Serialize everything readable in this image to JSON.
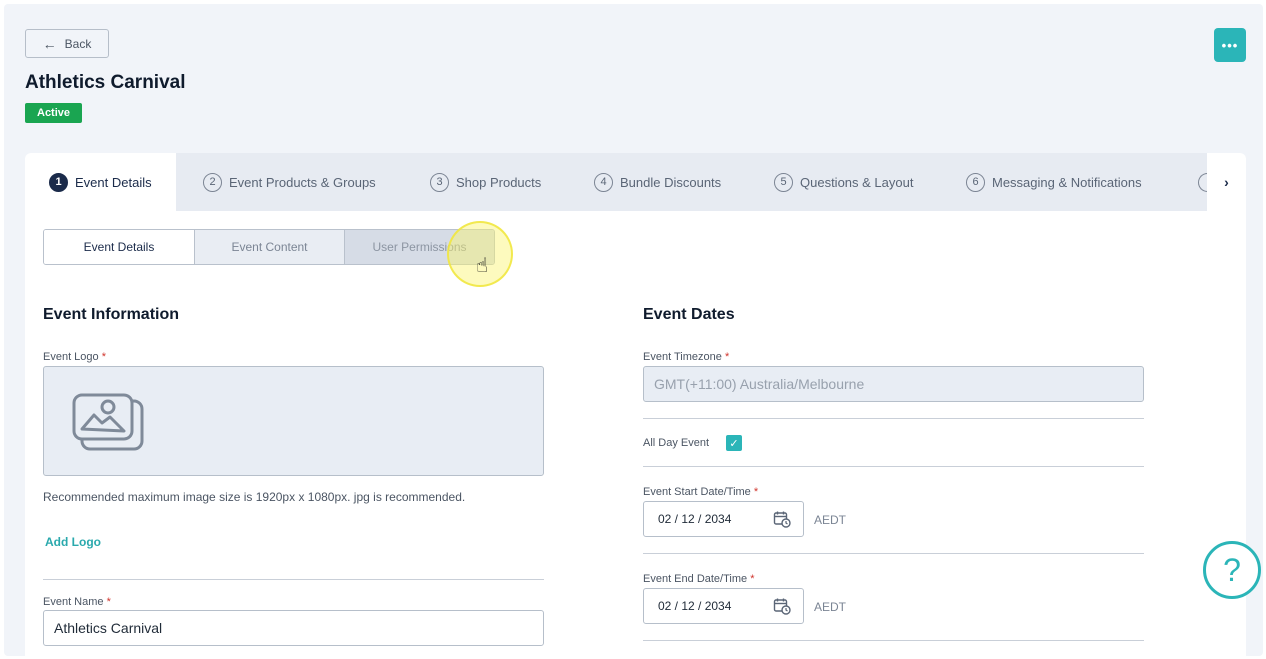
{
  "header": {
    "back_label": "Back",
    "more_label": "•••",
    "title": "Athletics Carnival",
    "status": "Active"
  },
  "tabs": [
    {
      "num": "1",
      "label": "Event Details"
    },
    {
      "num": "2",
      "label": "Event Products & Groups"
    },
    {
      "num": "3",
      "label": "Shop Products"
    },
    {
      "num": "4",
      "label": "Bundle Discounts"
    },
    {
      "num": "5",
      "label": "Questions & Layout"
    },
    {
      "num": "6",
      "label": "Messaging & Notifications"
    }
  ],
  "subtabs": [
    "Event Details",
    "Event Content",
    "User Permissions"
  ],
  "event_information": {
    "title": "Event Information",
    "logo_label": "Event Logo",
    "logo_hint": "Recommended maximum image size is 1920px x 1080px. jpg is recommended.",
    "add_logo": "Add Logo",
    "name_label": "Event Name",
    "name_value": "Athletics Carnival"
  },
  "event_dates": {
    "title": "Event Dates",
    "timezone_label": "Event Timezone",
    "timezone_value": "GMT(+11:00) Australia/Melbourne",
    "all_day_label": "All Day Event",
    "start_label": "Event Start Date/Time",
    "start_value": "02 / 12 / 2034",
    "start_tz": "AEDT",
    "end_label": "Event End Date/Time",
    "end_value": "02 / 12 / 2034",
    "end_tz": "AEDT"
  },
  "required_mark": "*",
  "help_label": "?"
}
